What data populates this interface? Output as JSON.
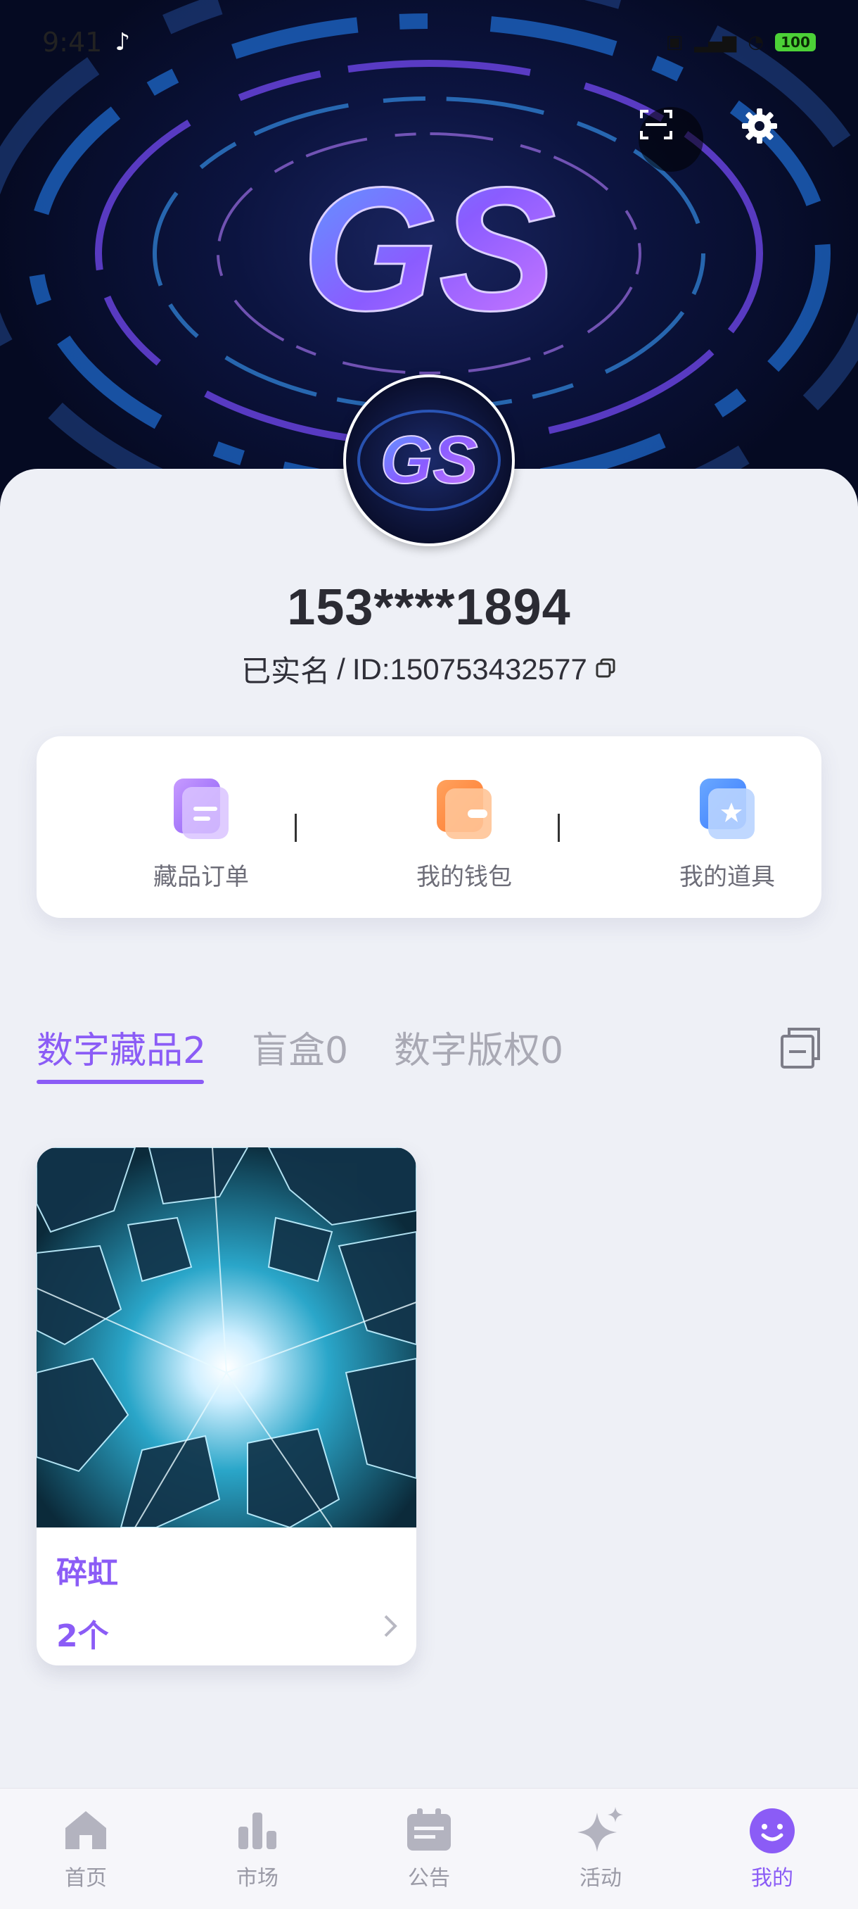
{
  "status_bar": {
    "time": "9:41",
    "battery": "100"
  },
  "profile": {
    "phone": "153****1894",
    "verified": "已实名",
    "separator": "/",
    "id_text": "ID:150753432577"
  },
  "quick_actions": [
    {
      "label": "藏品订单",
      "icon": "order-icon"
    },
    {
      "label": "我的钱包",
      "icon": "wallet-icon"
    },
    {
      "label": "我的道具",
      "icon": "props-icon"
    }
  ],
  "tabs": [
    {
      "label": "数字藏品2",
      "active": true
    },
    {
      "label": "盲盒0",
      "active": false
    },
    {
      "label": "数字版权0",
      "active": false
    }
  ],
  "collections": [
    {
      "name": "碎虹",
      "count": "2个"
    }
  ],
  "bottom_nav": [
    {
      "label": "首页",
      "icon": "home-icon",
      "active": false
    },
    {
      "label": "市场",
      "icon": "market-icon",
      "active": false
    },
    {
      "label": "公告",
      "icon": "announcement-icon",
      "active": false
    },
    {
      "label": "活动",
      "icon": "activity-icon",
      "active": false
    },
    {
      "label": "我的",
      "icon": "profile-icon",
      "active": true
    }
  ],
  "colors": {
    "accent": "#8b5cf6",
    "background": "#eef0f6"
  }
}
